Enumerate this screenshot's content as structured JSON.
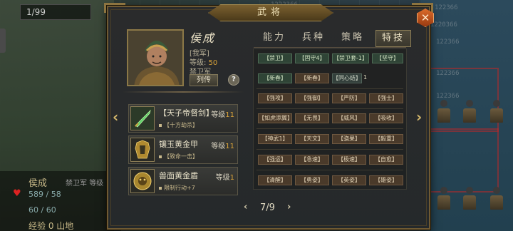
{
  "background": {
    "top_left_counter": "1/99",
    "left_unit": {
      "name": "侯成",
      "troop": "禁卫军",
      "level_label_partial": "等级",
      "hp": "589 / 58",
      "mp": "60 / 60",
      "exp": "经验 0 山地"
    },
    "numbers": [
      "1222366",
      "122366",
      "1220366",
      "122366",
      "122366",
      "122366"
    ]
  },
  "dialog": {
    "title": "武将",
    "close_icon": "crossed-swords-icon"
  },
  "hero": {
    "name": "侯成",
    "faction": "[我军]",
    "level_label": "等级:",
    "level_value": "50",
    "troop": "禁卫军",
    "bio_button": "列传",
    "help_button": "?"
  },
  "tabs": [
    {
      "label": "能力",
      "active": false
    },
    {
      "label": "兵种",
      "active": false
    },
    {
      "label": "策略",
      "active": false
    },
    {
      "label": "特技",
      "active": true
    }
  ],
  "equipment": [
    {
      "name": "【天子帝督剑】",
      "level_label": "等级",
      "level": "11",
      "desc": "【十方劫杀】",
      "icon": "sword-icon"
    },
    {
      "name": "镶玉黄金甲",
      "level_label": "等级",
      "level": "11",
      "desc": "【致命一击】",
      "icon": "armor-icon"
    },
    {
      "name": "兽面黄金盾",
      "level_label": "等级",
      "level": "1",
      "desc": "限制行动+7",
      "icon": "shield-icon"
    }
  ],
  "skills": {
    "row1": [
      "【禁卫】",
      "【固守4】",
      "【禁卫套-1】",
      "【坚守】"
    ],
    "row2": [
      "【新春】",
      "【新春】",
      "【同心结】"
    ],
    "row2_extra": "1",
    "row3": [
      "【强攻】",
      "【强御】",
      "【严防】",
      "【强士】"
    ],
    "row4": [
      "【如虎添翼】",
      "【无畏】",
      "【威风】",
      "【吸收】"
    ],
    "row5": [
      "【神武1】",
      "【天文】",
      "【骁果】",
      "【毅重】"
    ],
    "row6": [
      "【强运】",
      "【急速】",
      "【极速】",
      "【自愈】"
    ],
    "row7": [
      "【清醒】",
      "【勇姿】",
      "【英姿】",
      "【雄姿】"
    ]
  },
  "pager": {
    "text": "7/9",
    "prev": "‹",
    "next": "›"
  },
  "nav": {
    "left_arrow": "‹",
    "right_arrow": "›"
  }
}
